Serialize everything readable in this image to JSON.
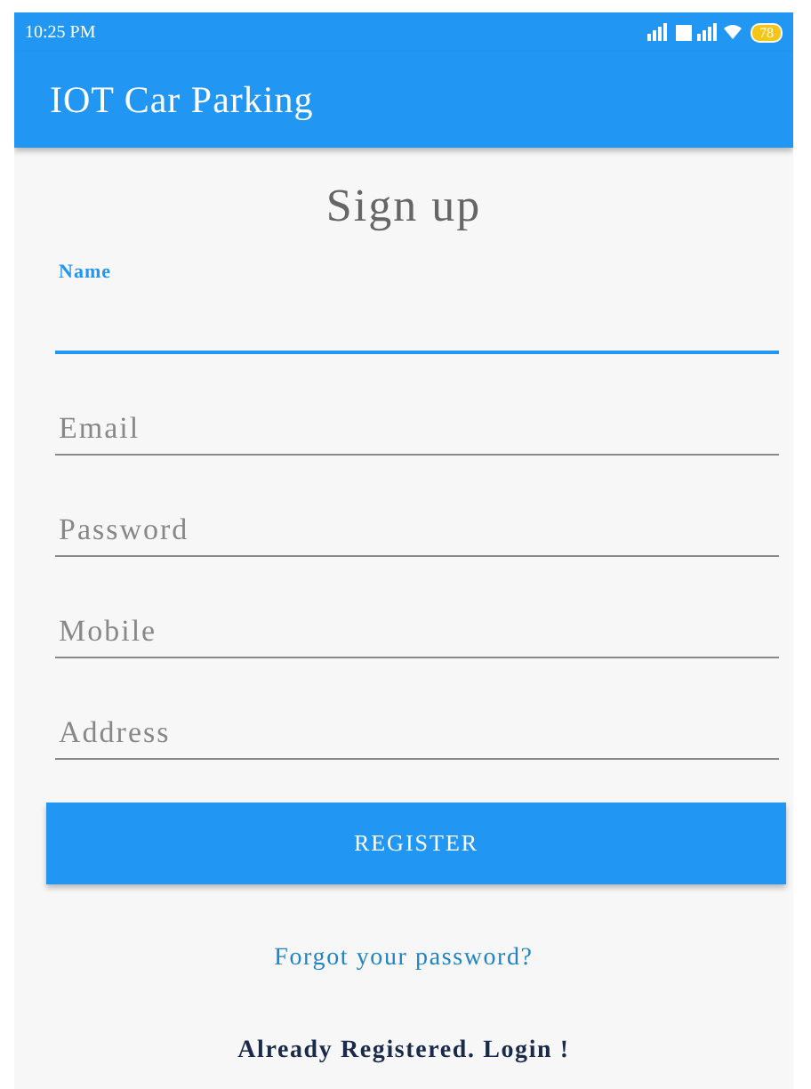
{
  "status_bar": {
    "time": "10:25 PM",
    "battery": "78"
  },
  "app_bar": {
    "title": "IOT Car Parking"
  },
  "heading": "Sign up",
  "fields": [
    {
      "label": "Name",
      "focused": true
    },
    {
      "label": "Email",
      "focused": false
    },
    {
      "label": "Password",
      "focused": false
    },
    {
      "label": "Mobile",
      "focused": false
    },
    {
      "label": "Address",
      "focused": false
    }
  ],
  "register_button": "REGISTER",
  "forgot_link": "Forgot your password?",
  "login_link": "Already Registered. Login !"
}
